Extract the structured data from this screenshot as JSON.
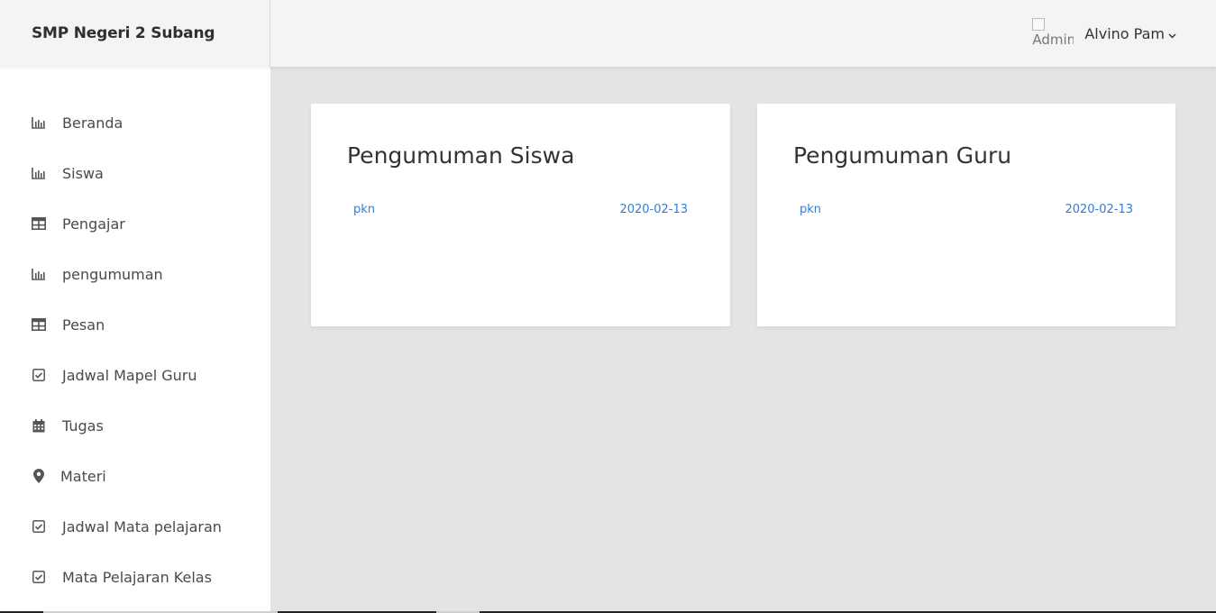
{
  "brand": {
    "title": "SMP Negeri 2 Subang"
  },
  "header": {
    "avatar_alt": "Admin",
    "user_name": "Alvino Pam"
  },
  "sidebar": {
    "items": [
      {
        "label": "Beranda",
        "icon": "bar-chart-icon"
      },
      {
        "label": "Siswa",
        "icon": "bar-chart-icon"
      },
      {
        "label": "Pengajar",
        "icon": "table-icon"
      },
      {
        "label": "pengumuman",
        "icon": "bar-chart-icon"
      },
      {
        "label": "Pesan",
        "icon": "table-icon"
      },
      {
        "label": "Jadwal Mapel Guru",
        "icon": "checkbox-icon"
      },
      {
        "label": "Tugas",
        "icon": "calendar-icon"
      },
      {
        "label": "Materi",
        "icon": "map-pin-icon"
      },
      {
        "label": "Jadwal Mata pelajaran",
        "icon": "checkbox-icon"
      },
      {
        "label": "Mata Pelajaran Kelas",
        "icon": "checkbox-icon"
      }
    ]
  },
  "cards": {
    "siswa": {
      "title": "Pengumuman Siswa",
      "items": [
        {
          "subject": "pkn",
          "date": "2020-02-13"
        }
      ]
    },
    "guru": {
      "title": "Pengumuman Guru",
      "items": [
        {
          "subject": "pkn",
          "date": "2020-02-13"
        }
      ]
    }
  },
  "colors": {
    "link": "#2f7ed8",
    "sidebar_bg": "#ffffff",
    "header_bg": "#f4f4f4",
    "content_bg": "#e4e4e4"
  }
}
